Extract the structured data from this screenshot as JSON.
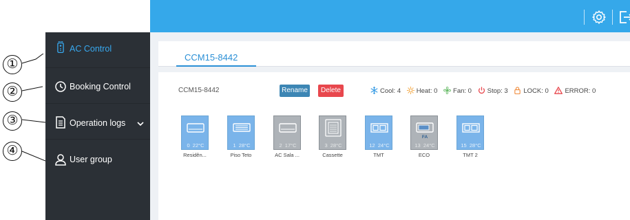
{
  "header": {
    "settings_icon": "gear-icon",
    "logout_icon": "logout-icon"
  },
  "sidebar": {
    "items": [
      {
        "label": "AC Control",
        "icon": "remote-icon",
        "active": true
      },
      {
        "label": "Booking Control",
        "icon": "clock-icon",
        "active": false
      },
      {
        "label": "Operation logs",
        "icon": "document-icon",
        "active": false
      },
      {
        "label": "User group",
        "icon": "user-icon",
        "active": false
      }
    ]
  },
  "annotations": [
    "①",
    "②",
    "③",
    "④"
  ],
  "tabs": [
    {
      "label": "CCM15-8442",
      "active": true
    }
  ],
  "device": {
    "name": "CCM15-8442",
    "rename_label": "Rename",
    "delete_label": "Delete",
    "stats": {
      "cool": "Cool: 4",
      "heat": "Heat: 0",
      "fan": "Fan: 0",
      "stop": "Stop: 3",
      "lock": "LOCK: 0",
      "error": "ERROR: 0"
    }
  },
  "units": [
    {
      "name": "Residên...",
      "id": "0",
      "temp": "22°C",
      "state": "on",
      "type": "wall",
      "tag": ""
    },
    {
      "name": "Piso Teto",
      "id": "1",
      "temp": "28°C",
      "state": "on",
      "type": "floor-ceiling",
      "tag": ""
    },
    {
      "name": "AC Sala ...",
      "id": "2",
      "temp": "17°C",
      "state": "off",
      "type": "wall",
      "tag": ""
    },
    {
      "name": "Cassette",
      "id": "3",
      "temp": "28°C",
      "state": "off",
      "type": "cassette",
      "tag": ""
    },
    {
      "name": "TMT",
      "id": "12",
      "temp": "24°C",
      "state": "on",
      "type": "duct",
      "tag": ""
    },
    {
      "name": "ECO",
      "id": "13",
      "temp": "24°C",
      "state": "off",
      "type": "fresh-air",
      "tag": "FA"
    },
    {
      "name": "TMT 2",
      "id": "15",
      "temp": "28°C",
      "state": "on",
      "type": "duct",
      "tag": ""
    }
  ],
  "colors": {
    "accent": "#35a8ea",
    "sidebar": "#2b3036",
    "on_unit": "#7ab4ea",
    "off_unit": "#aeb3b8",
    "delete": "#e8474d",
    "rename": "#3d86b4"
  }
}
